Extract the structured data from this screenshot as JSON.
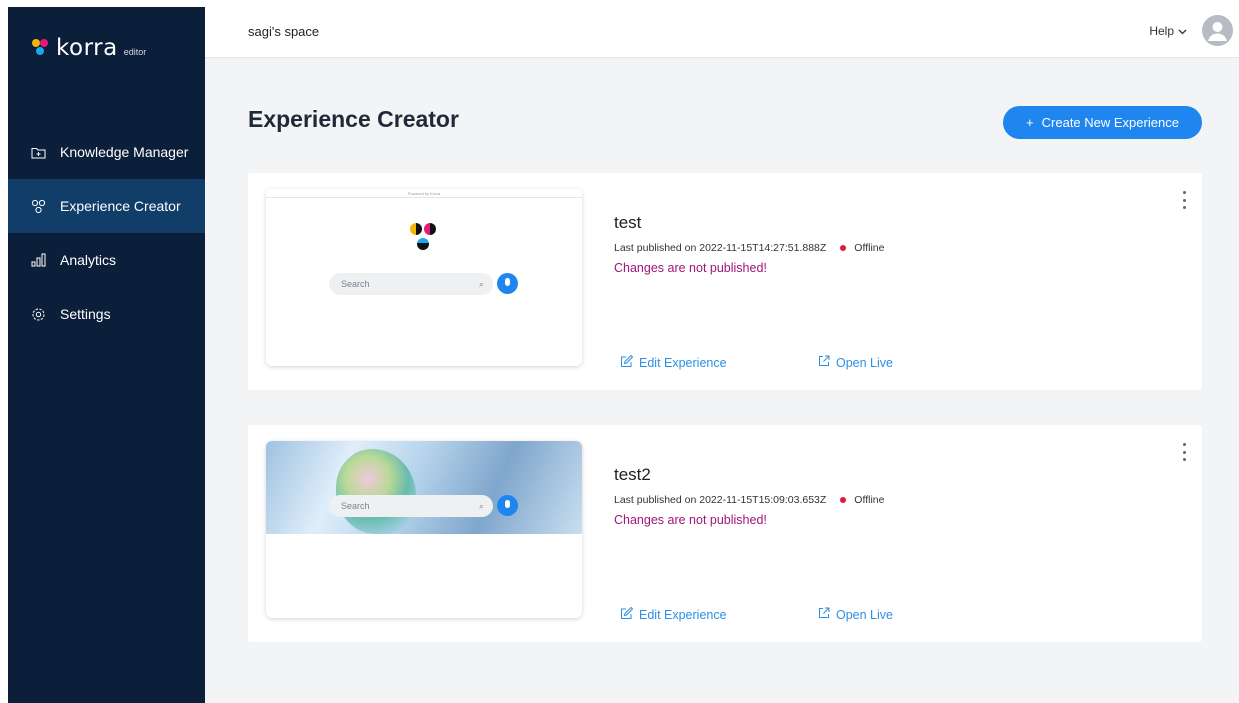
{
  "brand": {
    "name": "korra",
    "product": "editor"
  },
  "header": {
    "space_name": "sagi's space",
    "help_label": "Help"
  },
  "sidebar": {
    "items": [
      {
        "label": "Knowledge Manager",
        "icon": "folder-plus-icon"
      },
      {
        "label": "Experience Creator",
        "icon": "nodes-icon",
        "active": true
      },
      {
        "label": "Analytics",
        "icon": "bar-chart-icon"
      },
      {
        "label": "Settings",
        "icon": "gear-icon"
      }
    ]
  },
  "main": {
    "title": "Experience Creator",
    "create_button": "Create New Experience",
    "create_icon": "+",
    "experiences": [
      {
        "name": "test",
        "last_published": "Last published on 2022-11-15T14:27:51.888Z",
        "status": "Offline",
        "warning": "Changes are not published!",
        "edit_label": "Edit Experience",
        "open_label": "Open Live",
        "thumb": {
          "powered_by": "Powered by Korra",
          "search_placeholder": "Search"
        }
      },
      {
        "name": "test2",
        "last_published": "Last published on 2022-11-15T15:09:03.653Z",
        "status": "Offline",
        "warning": "Changes are not published!",
        "edit_label": "Edit Experience",
        "open_label": "Open Live",
        "thumb": {
          "search_placeholder": "Search"
        }
      }
    ]
  },
  "colors": {
    "sidebar_bg": "#0c1f3a",
    "sidebar_active": "#113d69",
    "primary": "#1f86f0",
    "warning": "#a0167a",
    "offline_dot": "#e1183a",
    "link": "#2c8fe6"
  }
}
